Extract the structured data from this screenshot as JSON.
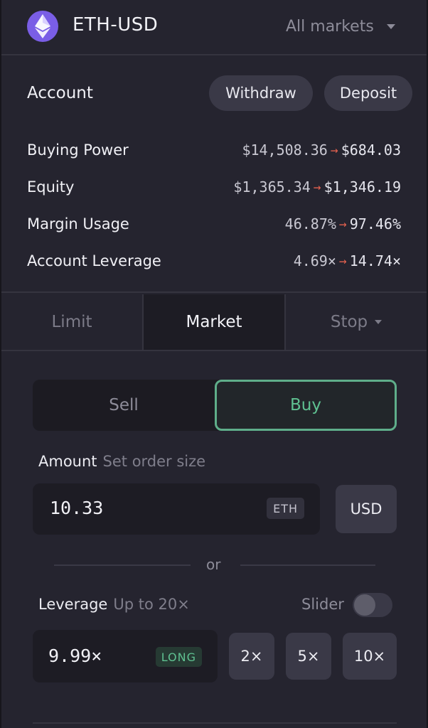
{
  "header": {
    "market": "ETH-USD",
    "all_markets": "All markets",
    "logo_color": "#7a5ee6"
  },
  "account": {
    "title": "Account",
    "withdraw_label": "Withdraw",
    "deposit_label": "Deposit",
    "rows": [
      {
        "label": "Buying Power",
        "current": "$14,508.36",
        "projected": "$684.03"
      },
      {
        "label": "Equity",
        "current": "$1,365.34",
        "projected": "$1,346.19"
      },
      {
        "label": "Margin Usage",
        "current": "46.87%",
        "projected": "97.46%"
      },
      {
        "label": "Account Leverage",
        "current": "4.69×",
        "projected": "14.74×"
      }
    ],
    "arrow": "→",
    "arrow_color": "#e3614f"
  },
  "order_tabs": {
    "limit": "Limit",
    "market": "Market",
    "stop": "Stop",
    "active": "Market"
  },
  "side": {
    "sell_label": "Sell",
    "buy_label": "Buy",
    "selected": "Buy",
    "buy_color": "#5fc191"
  },
  "amount": {
    "label": "Amount",
    "hint": "Set order size",
    "value": "10.33",
    "unit": "ETH",
    "toggle_unit": "USD"
  },
  "divider": {
    "or_text": "or"
  },
  "leverage": {
    "label": "Leverage",
    "hint": "Up to 20×",
    "slider_label": "Slider",
    "slider_enabled": false,
    "value": "9.99×",
    "direction": "LONG",
    "presets": [
      "2×",
      "5×",
      "10×"
    ]
  }
}
